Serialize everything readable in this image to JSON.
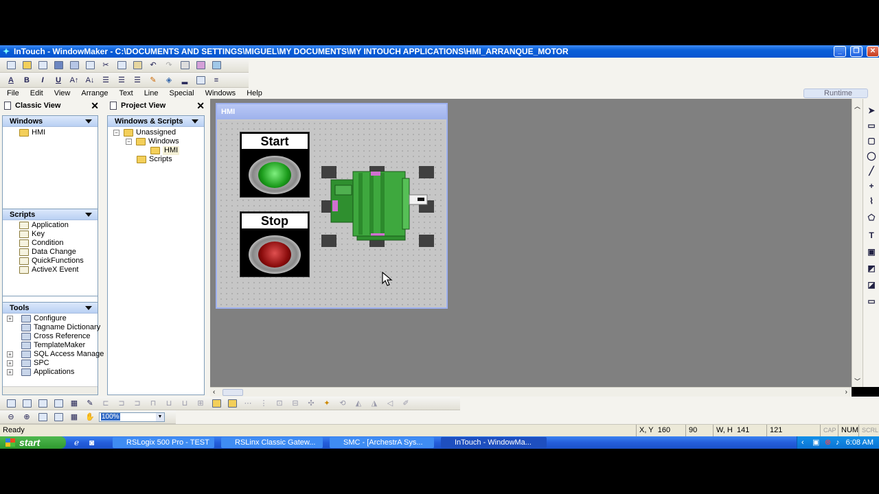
{
  "window": {
    "title": "InTouch - WindowMaker - C:\\DOCUMENTS AND SETTINGS\\MIGUEL\\MY DOCUMENTS\\MY INTOUCH APPLICATIONS\\HMI_ARRANQUE_MOTOR"
  },
  "menu": {
    "items": [
      "File",
      "Edit",
      "View",
      "Arrange",
      "Text",
      "Line",
      "Special",
      "Windows",
      "Help"
    ],
    "runtime": "Runtime"
  },
  "classic_view": {
    "title": "Classic View",
    "windows": {
      "header": "Windows",
      "items": [
        "HMI"
      ]
    },
    "scripts": {
      "header": "Scripts",
      "items": [
        "Application",
        "Key",
        "Condition",
        "Data Change",
        "QuickFunctions",
        "ActiveX Event"
      ]
    },
    "tools": {
      "header": "Tools",
      "items": [
        "Configure",
        "Tagname Dictionary",
        "Cross Reference",
        "TemplateMaker",
        "SQL Access Manage",
        "SPC",
        "Applications"
      ]
    }
  },
  "project_view": {
    "title": "Project View",
    "header": "Windows & Scripts",
    "tree": [
      "Unassigned",
      "Windows",
      "HMI",
      "Scripts"
    ]
  },
  "hmi_window": {
    "title": "HMI",
    "start_label": "Start",
    "stop_label": "Stop",
    "start_color": "#1a9a1a",
    "stop_color": "#8a0c0c"
  },
  "zoom": "100%",
  "status": {
    "ready": "Ready",
    "xy_label": "X, Y",
    "x": "160",
    "y": "90",
    "wh_label": "W, H",
    "w": "141",
    "h": "121",
    "cap": "CAP",
    "num": "NUM",
    "scrl": "SCRL"
  },
  "taskbar": {
    "start": "start",
    "tasks": [
      "RSLogix 500 Pro - TEST",
      "RSLinx Classic Gatew...",
      "SMC - [ArchestrA Sys...",
      "InTouch - WindowMa..."
    ],
    "clock": "6:08 AM"
  }
}
